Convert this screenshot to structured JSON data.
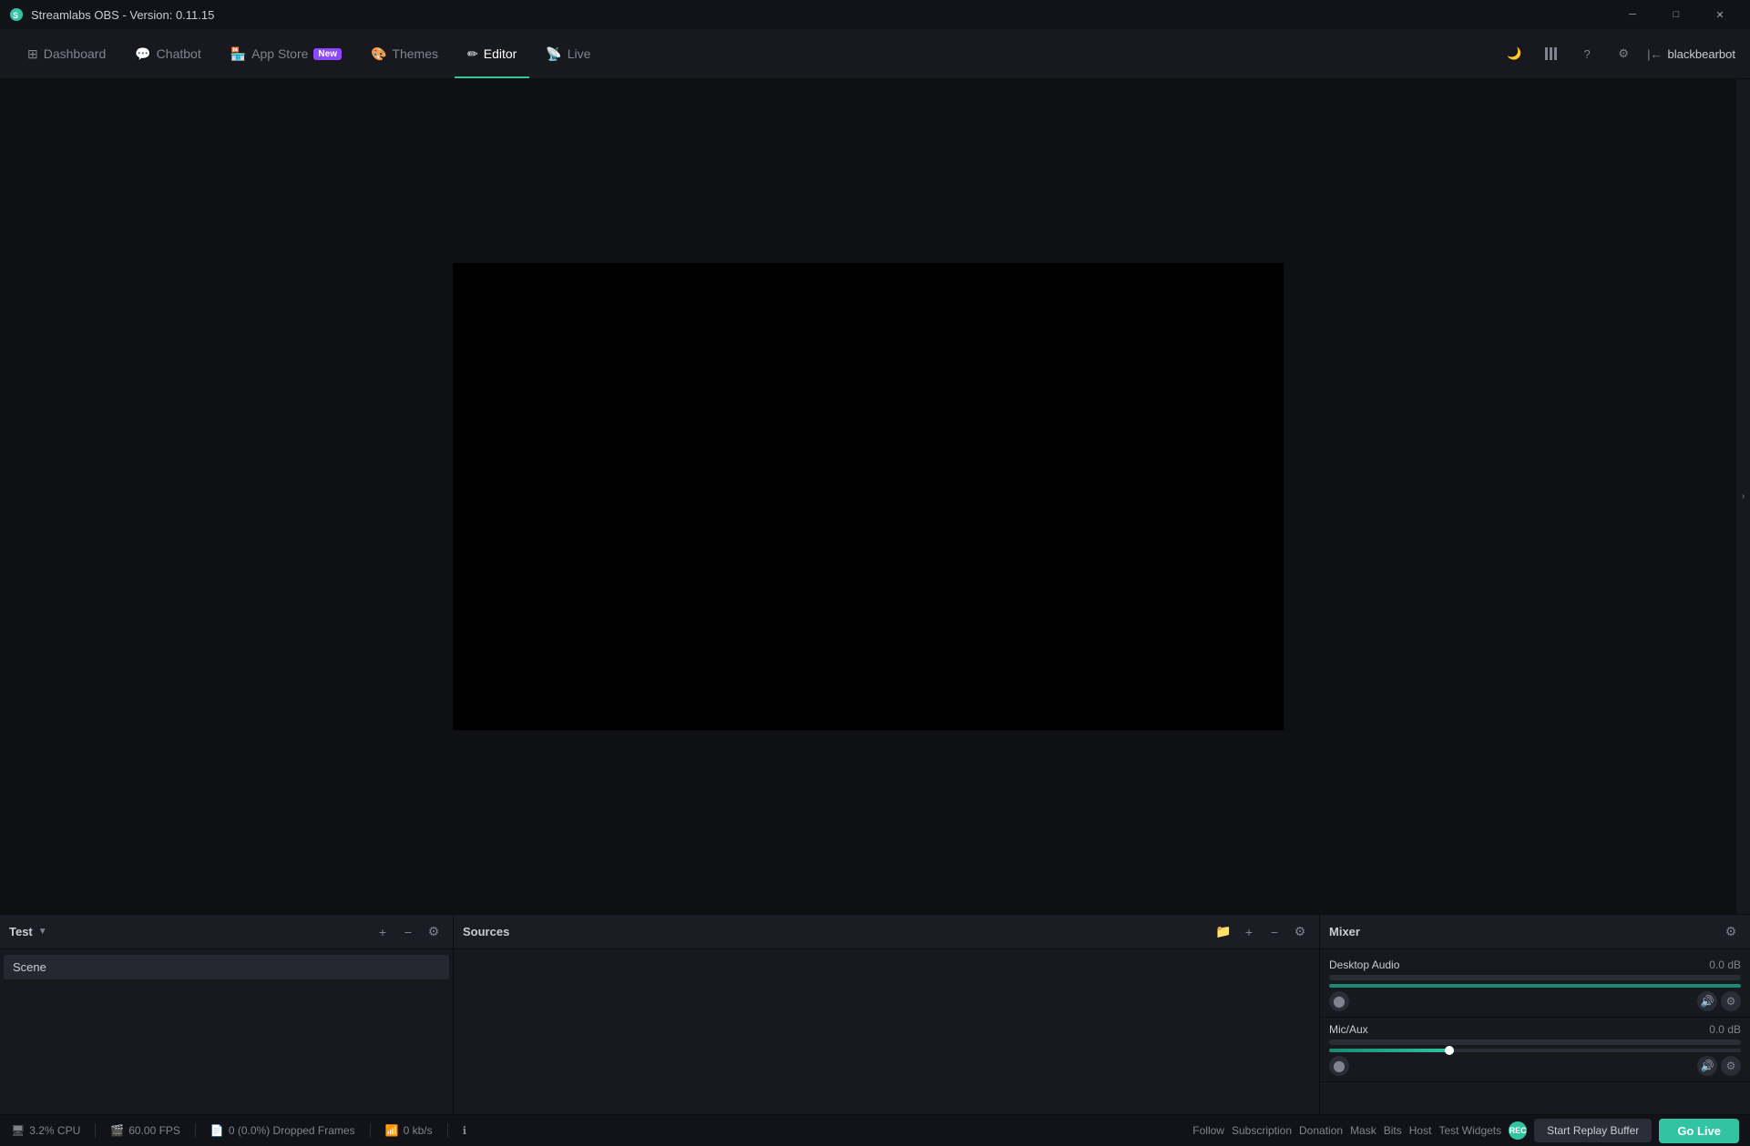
{
  "titlebar": {
    "title": "Streamlabs OBS - Version: 0.11.15",
    "controls": {
      "minimize": "─",
      "maximize": "□",
      "close": "✕"
    }
  },
  "navbar": {
    "items": [
      {
        "id": "dashboard",
        "label": "Dashboard",
        "active": false,
        "icon": "dashboard-icon"
      },
      {
        "id": "chatbot",
        "label": "Chatbot",
        "active": false,
        "icon": "chatbot-icon"
      },
      {
        "id": "appstore",
        "label": "App Store",
        "active": false,
        "badge": "New",
        "icon": "appstore-icon"
      },
      {
        "id": "themes",
        "label": "Themes",
        "active": false,
        "icon": "themes-icon"
      },
      {
        "id": "editor",
        "label": "Editor",
        "active": true,
        "icon": "editor-icon"
      },
      {
        "id": "live",
        "label": "Live",
        "active": false,
        "icon": "live-icon"
      }
    ],
    "right": {
      "theme_icon": "🌙",
      "columns_icon": "columns",
      "help_icon": "?",
      "settings_icon": "⚙",
      "username": "blackbearbot"
    }
  },
  "preview": {
    "background": "#000000"
  },
  "scenes_panel": {
    "title": "Test",
    "actions": [
      "+",
      "−",
      "⚙"
    ],
    "items": [
      {
        "label": "Scene"
      }
    ]
  },
  "sources_panel": {
    "title": "Sources",
    "actions": [
      "folder",
      "+",
      "−",
      "⚙"
    ]
  },
  "mixer_panel": {
    "title": "Mixer",
    "settings_icon": "⚙",
    "channels": [
      {
        "name": "Desktop Audio",
        "db": "0.0 dB",
        "volume_pct": 100
      },
      {
        "name": "Mic/Aux",
        "db": "0.0 dB",
        "volume_pct": 30
      }
    ]
  },
  "statusbar": {
    "cpu": "3.2% CPU",
    "fps": "60.00 FPS",
    "dropped": "0 (0.0%) Dropped Frames",
    "bandwidth": "0 kb/s",
    "info_icon": "ℹ",
    "footer_links": [
      "Follow",
      "Subscription",
      "Donation",
      "Mask",
      "Bits",
      "Host",
      "Test Widgets"
    ],
    "replay_button": "Start Replay Buffer",
    "golive_button": "Go Live"
  }
}
